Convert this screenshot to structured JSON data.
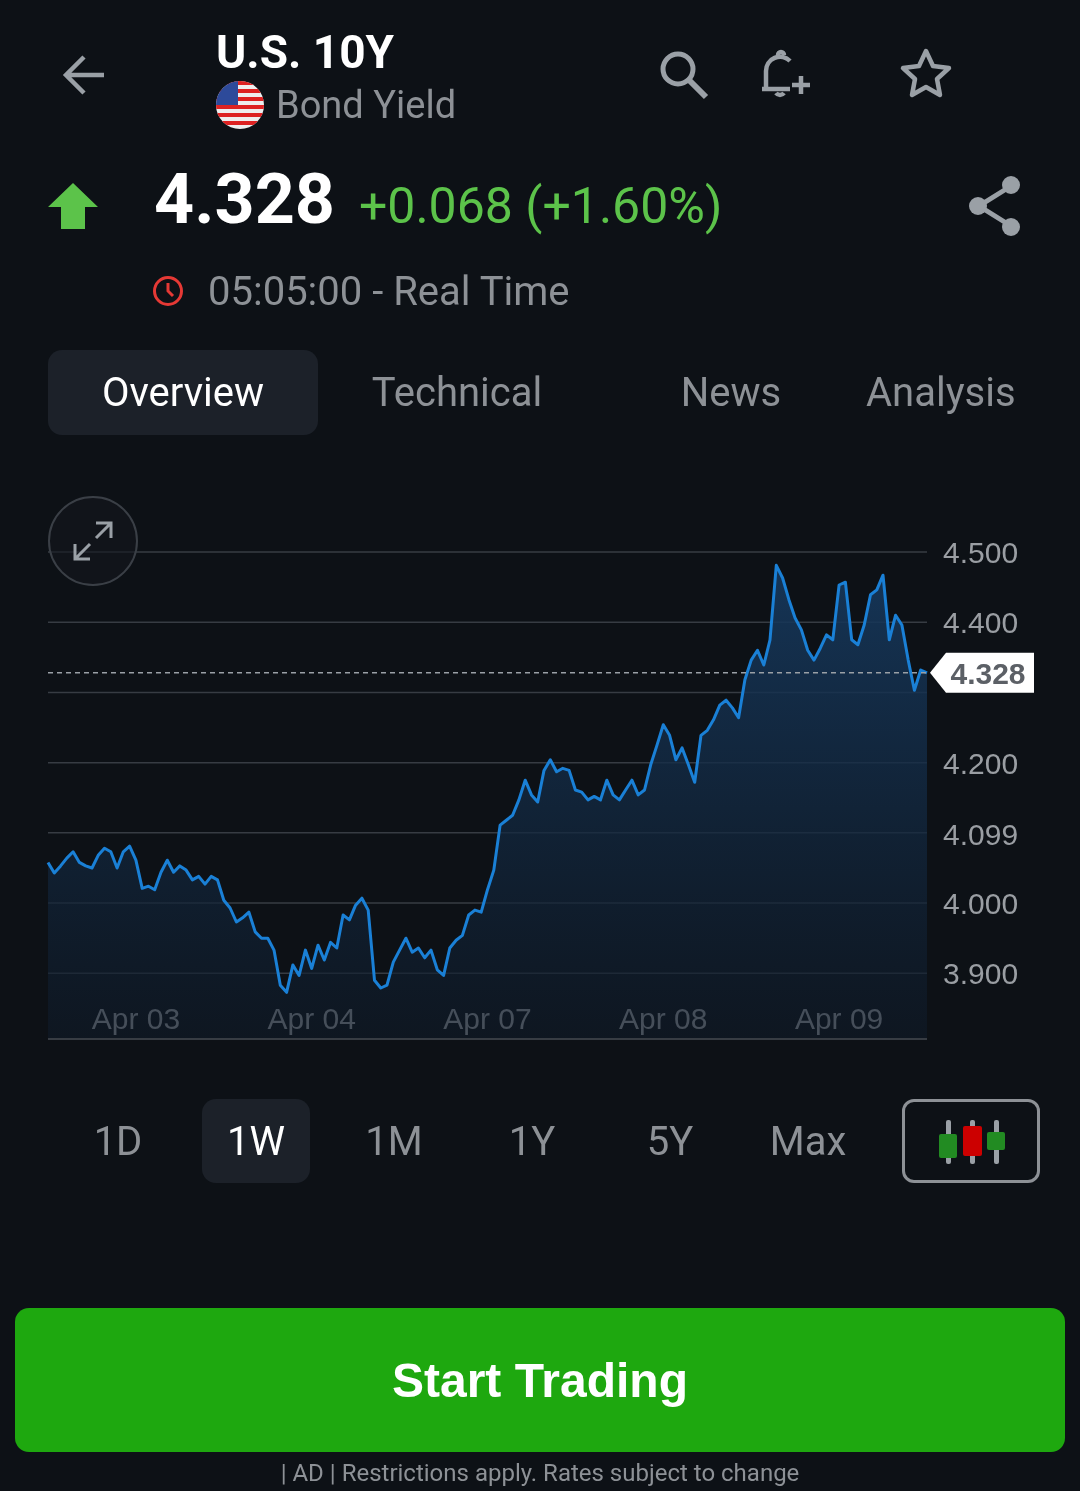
{
  "header": {
    "title": "U.S. 10Y",
    "subtitle": "Bond Yield"
  },
  "quote": {
    "rising": true,
    "price": "4.328",
    "change": "+0.068 (+1.60%)",
    "time": "05:05:00 - Real Time"
  },
  "tabs": [
    {
      "label": "Overview",
      "selected": true
    },
    {
      "label": "Technical",
      "selected": false
    },
    {
      "label": "News",
      "selected": false
    },
    {
      "label": "Analysis",
      "selected": false
    }
  ],
  "chart": {
    "chart_data": {
      "type": "area",
      "grid": true,
      "ylim": [
        3.805,
        4.5
      ],
      "categories": [
        null,
        null,
        null,
        null,
        null,
        null,
        null,
        null,
        null,
        null,
        null,
        null,
        null,
        null,
        "Apr 03",
        null,
        null,
        null,
        null,
        null,
        null,
        null,
        null,
        null,
        null,
        null,
        null,
        null,
        null,
        null,
        null,
        null,
        null,
        null,
        null,
        null,
        null,
        null,
        null,
        null,
        null,
        null,
        "Apr 04",
        null,
        null,
        null,
        null,
        null,
        null,
        null,
        null,
        null,
        null,
        null,
        null,
        null,
        null,
        null,
        null,
        null,
        null,
        null,
        null,
        null,
        null,
        null,
        null,
        null,
        null,
        null,
        "Apr 07",
        null,
        null,
        null,
        null,
        null,
        null,
        null,
        null,
        null,
        null,
        null,
        null,
        null,
        null,
        null,
        null,
        null,
        null,
        null,
        null,
        null,
        null,
        null,
        null,
        null,
        null,
        null,
        "Apr 08",
        null,
        null,
        null,
        null,
        null,
        null,
        null,
        null,
        null,
        null,
        null,
        null,
        null,
        null,
        null,
        null,
        null,
        null,
        null,
        null,
        null,
        null,
        null,
        null,
        null,
        null,
        null,
        "Apr 09",
        null,
        null,
        null,
        null,
        null,
        null,
        null,
        null,
        null,
        null,
        null,
        null,
        null,
        null
      ],
      "yticks": [
        {
          "value": 4.5,
          "label": "4.500"
        },
        {
          "value": 4.4,
          "label": "4.400"
        },
        {
          "value": 4.2,
          "label": "4.200"
        },
        {
          "value": 4.099,
          "label": "4.099"
        },
        {
          "value": 4.0,
          "label": "4.000"
        },
        {
          "value": 3.9,
          "label": "3.900"
        }
      ],
      "series": [
        {
          "color": "#1a80d6",
          "values": [
            4.058,
            4.043,
            4.053,
            4.064,
            4.073,
            4.058,
            4.053,
            4.05,
            4.068,
            4.078,
            4.073,
            4.05,
            4.073,
            4.081,
            4.061,
            4.021,
            4.024,
            4.019,
            4.044,
            4.061,
            4.044,
            4.053,
            4.047,
            4.033,
            4.038,
            4.027,
            4.038,
            4.033,
            4.004,
            3.993,
            3.973,
            3.979,
            3.987,
            3.959,
            3.95,
            3.95,
            3.933,
            3.883,
            3.873,
            3.912,
            3.897,
            3.933,
            3.907,
            3.94,
            3.919,
            3.944,
            3.936,
            3.983,
            3.976,
            3.997,
            4.007,
            3.99,
            3.89,
            3.879,
            3.883,
            3.916,
            3.933,
            3.95,
            3.93,
            3.936,
            3.922,
            3.933,
            3.905,
            3.897,
            3.936,
            3.947,
            3.954,
            3.983,
            3.99,
            3.987,
            4.019,
            4.047,
            4.111,
            4.118,
            4.125,
            4.147,
            4.175,
            4.154,
            4.144,
            4.189,
            4.204,
            4.187,
            4.192,
            4.189,
            4.161,
            4.158,
            4.147,
            4.152,
            4.147,
            4.175,
            4.154,
            4.147,
            4.161,
            4.175,
            4.154,
            4.161,
            4.197,
            4.225,
            4.254,
            4.239,
            4.204,
            4.221,
            4.197,
            4.172,
            4.239,
            4.246,
            4.261,
            4.282,
            4.289,
            4.278,
            4.264,
            4.318,
            4.346,
            4.36,
            4.339,
            4.375,
            4.481,
            4.463,
            4.432,
            4.406,
            4.389,
            4.36,
            4.346,
            4.363,
            4.382,
            4.375,
            4.453,
            4.457,
            4.375,
            4.368,
            4.396,
            4.439,
            4.446,
            4.467,
            4.375,
            4.41,
            4.396,
            4.346,
            4.303,
            4.332,
            4.328
          ]
        }
      ],
      "ref_lines": [
        {
          "axis": "y",
          "value": 4.328,
          "label": "4.328"
        }
      ]
    }
  },
  "ranges": [
    {
      "label": "1D",
      "selected": false
    },
    {
      "label": "1W",
      "selected": true
    },
    {
      "label": "1M",
      "selected": false
    },
    {
      "label": "1Y",
      "selected": false
    },
    {
      "label": "5Y",
      "selected": false
    },
    {
      "label": "Max",
      "selected": false
    }
  ],
  "cta": {
    "label": "Start Trading"
  },
  "disclaimer": "| AD | Restrictions apply. Rates subject to change"
}
